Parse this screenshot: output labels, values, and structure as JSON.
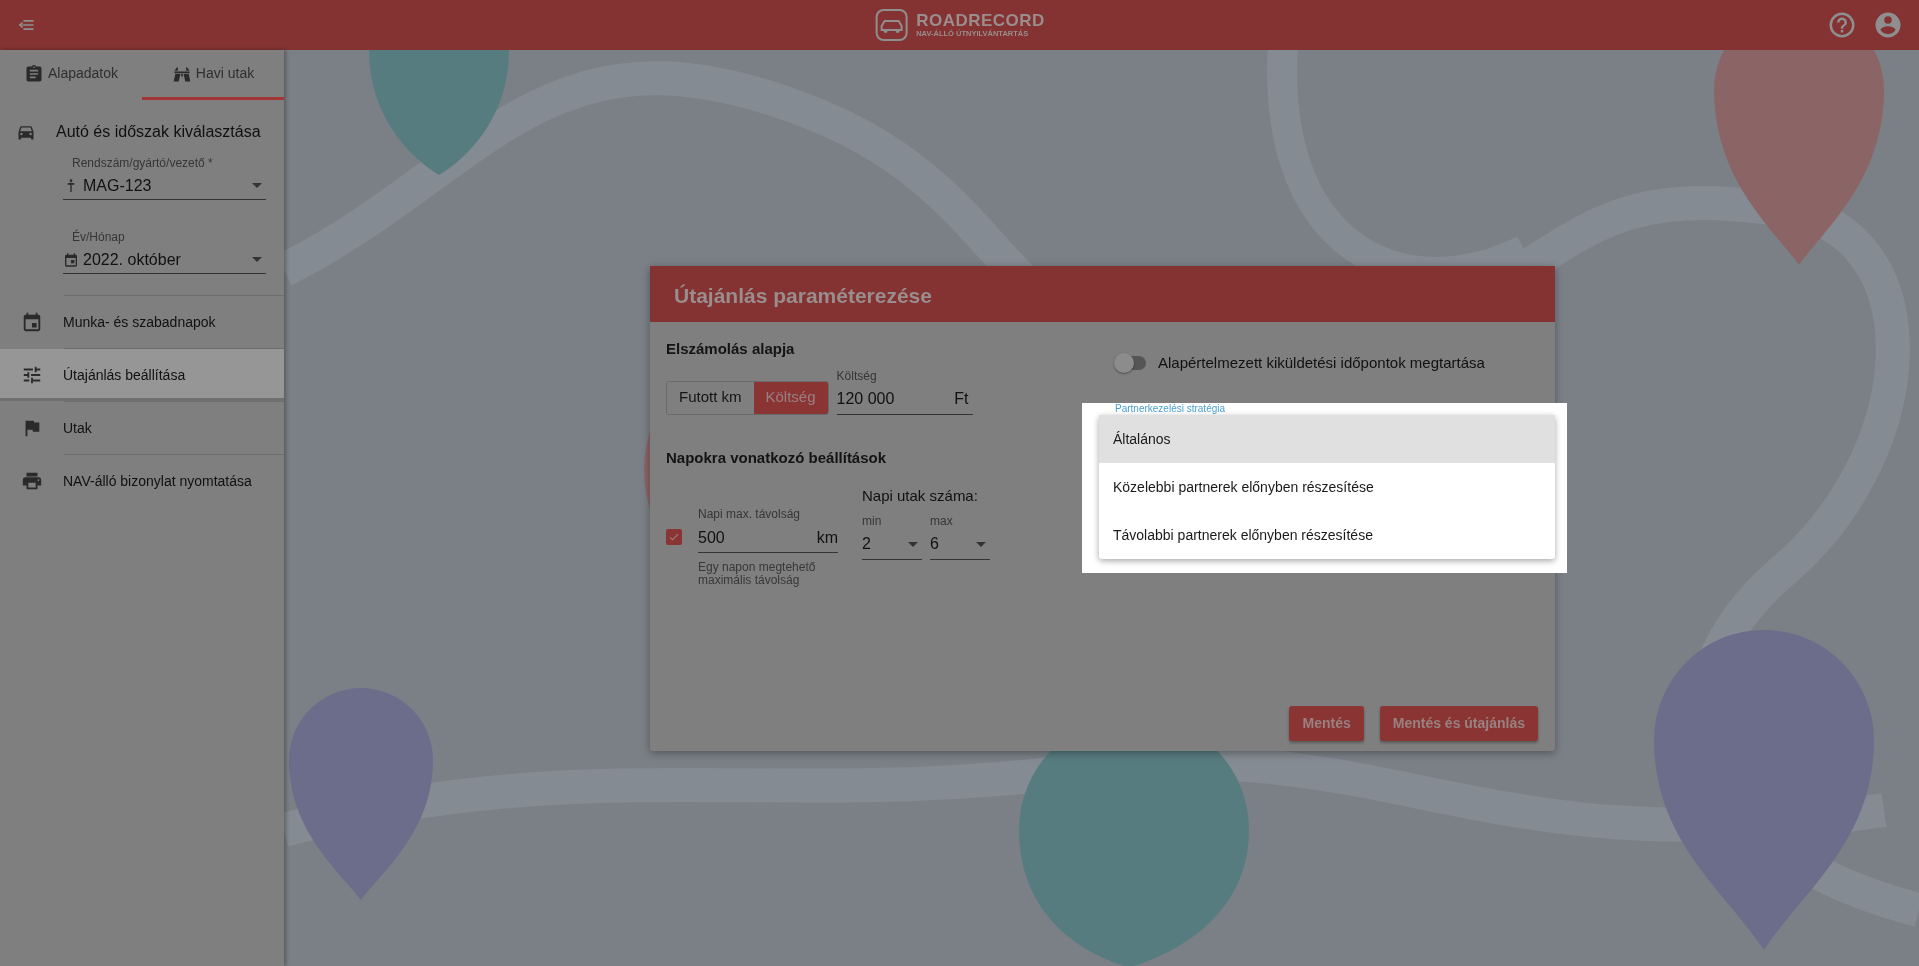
{
  "header": {
    "logo_title": "ROADRECORD",
    "logo_subtitle": "NAV-ÁLLÓ ÚTNYILVÁNTARTÁS"
  },
  "sidebar": {
    "tabs": [
      {
        "label": "Alapadatok",
        "selected": false
      },
      {
        "label": "Havi utak",
        "selected": true
      }
    ],
    "section_title": "Autó és időszak kiválasztása",
    "fields": [
      {
        "label": "Rendszám/gyártó/vezető *",
        "value": "MAG-123"
      },
      {
        "label": "Év/Hónap",
        "value": "2022. október"
      }
    ],
    "menu": [
      {
        "label": "Munka- és szabadnapok",
        "selected": false
      },
      {
        "label": "Útajánlás beállítása",
        "selected": true
      },
      {
        "label": "Utak",
        "selected": false
      },
      {
        "label": "NAV-álló bizonylat nyomtatása",
        "selected": false
      }
    ]
  },
  "dialog": {
    "title": "Útajánlás paraméterezése",
    "billing": {
      "heading": "Elszámolás alapja",
      "options": [
        {
          "label": "Futott km",
          "selected": false
        },
        {
          "label": "Költség",
          "selected": true
        }
      ],
      "amount": {
        "label": "Költség",
        "value": "120 000",
        "unit": "Ft"
      }
    },
    "toggle": {
      "label": "Alapértelmezett kiküldetési időpontok megtartása",
      "on": false
    },
    "strategy": {
      "label": "Partnerkezelési stratégia",
      "options": [
        {
          "label": "Általános",
          "selected": true
        },
        {
          "label": "Közelebbi partnerek előnyben részesítése",
          "selected": false
        },
        {
          "label": "Távolabbi partnerek előnyben részesítése",
          "selected": false
        }
      ]
    },
    "days": {
      "heading": "Napokra vonatkozó beállítások",
      "max_distance": {
        "checked": true,
        "label": "Napi max. távolság",
        "value": "500",
        "unit": "km",
        "hint": "Egy napon megtehető maximális távolság"
      },
      "trips": {
        "heading": "Napi utak száma:",
        "min": {
          "label": "min",
          "value": "2"
        },
        "max": {
          "label": "max",
          "value": "6"
        }
      }
    },
    "buttons": [
      "Mentés",
      "Mentés és útajánlás"
    ]
  }
}
